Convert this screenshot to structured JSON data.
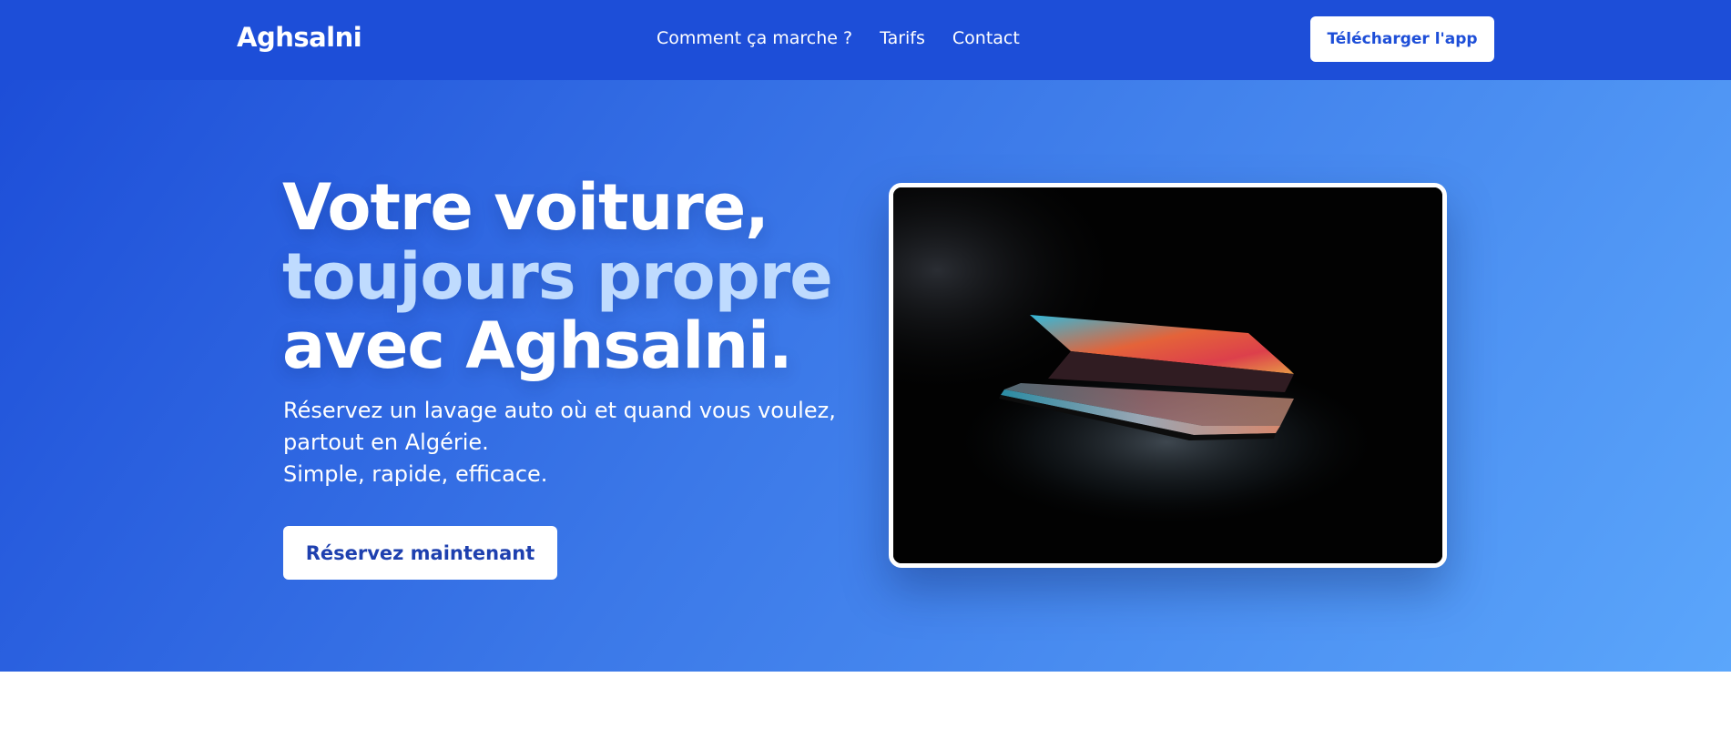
{
  "navbar": {
    "logo": "Aghsalni",
    "links": [
      "Comment ça marche ?",
      "Tarifs",
      "Contact"
    ],
    "download_label": "Télécharger l'app"
  },
  "hero": {
    "title_line1": "Votre voiture,",
    "title_line2": "toujours propre",
    "title_line3": "avec Aghsalni.",
    "subtitle_line1": "Réservez un lavage auto où et quand vous voulez,",
    "subtitle_line2": "partout en Algérie.",
    "subtitle_line3": "Simple, rapide, efficace.",
    "cta_label": "Réservez maintenant",
    "image_icon": "laptop-photo"
  },
  "colors": {
    "brand_blue": "#1d4ed8",
    "accent_light": "#bfdbfe",
    "gradient_end": "#5ba6fb"
  }
}
